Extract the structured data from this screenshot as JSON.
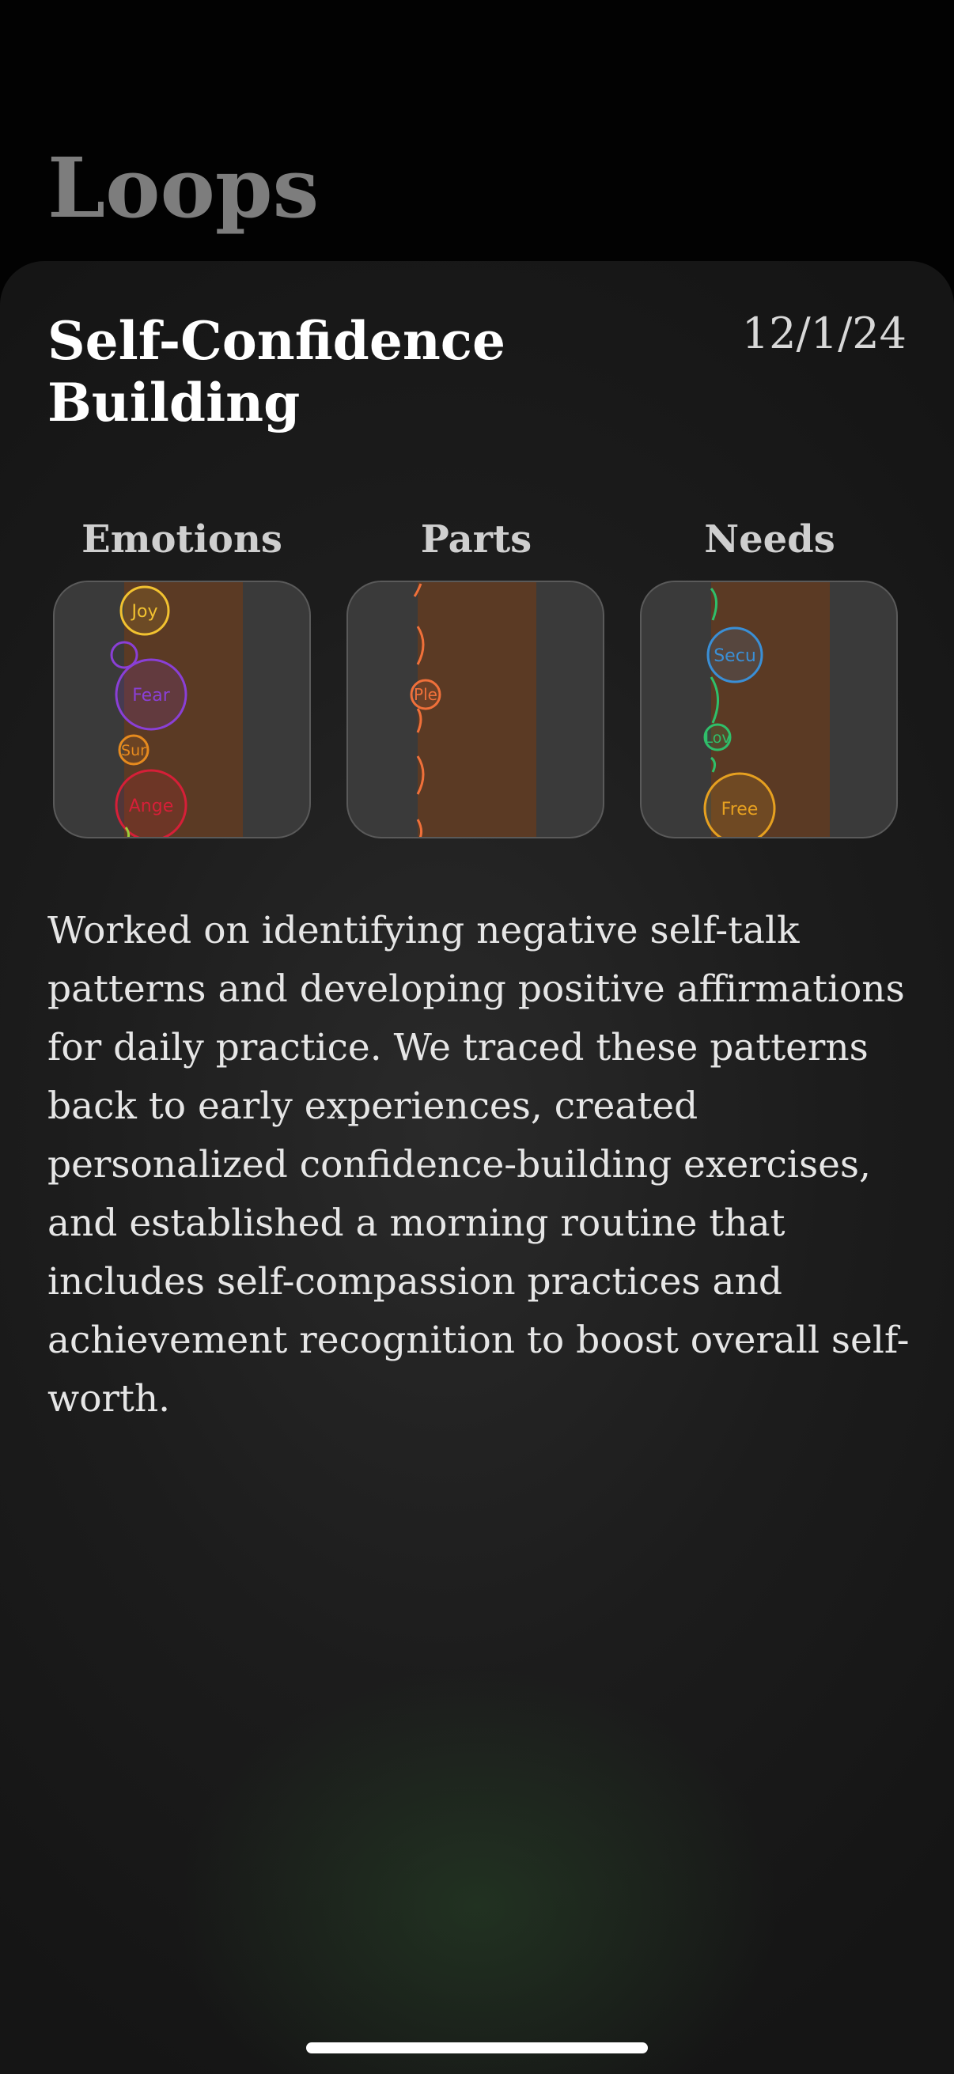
{
  "header": {
    "title": "Loops"
  },
  "entry": {
    "title": "Self-Confidence Building",
    "date": "12/1/24",
    "notes": "Worked on identifying negative self-talk patterns and developing positive affirmations for daily practice. We traced these patterns back to early experiences, created personalized confidence-building exercises, and established a morning routine that includes self-compassion practices and achievement recognition to boost overall self-worth."
  },
  "columns": [
    {
      "label": "Emotions",
      "bubbles": [
        {
          "label": "Joy",
          "color": "#f2c230"
        },
        {
          "label": "Fear",
          "color": "#8a3fd6"
        },
        {
          "label": "Sur",
          "color": "#e68a1e"
        },
        {
          "label": "Ange",
          "color": "#d61f38"
        }
      ]
    },
    {
      "label": "Parts",
      "bubbles": [
        {
          "label": "Ple",
          "color": "#f0703a"
        }
      ]
    },
    {
      "label": "Needs",
      "bubbles": [
        {
          "label": "Secu",
          "color": "#3a8fd6"
        },
        {
          "label": "Lov",
          "color": "#2fbf6a"
        },
        {
          "label": "Free",
          "color": "#e6a020"
        }
      ]
    }
  ],
  "colors": {
    "band": "#5b3a24",
    "tile": "#3a3a3a",
    "accent_glow": "#2b4a2b"
  }
}
